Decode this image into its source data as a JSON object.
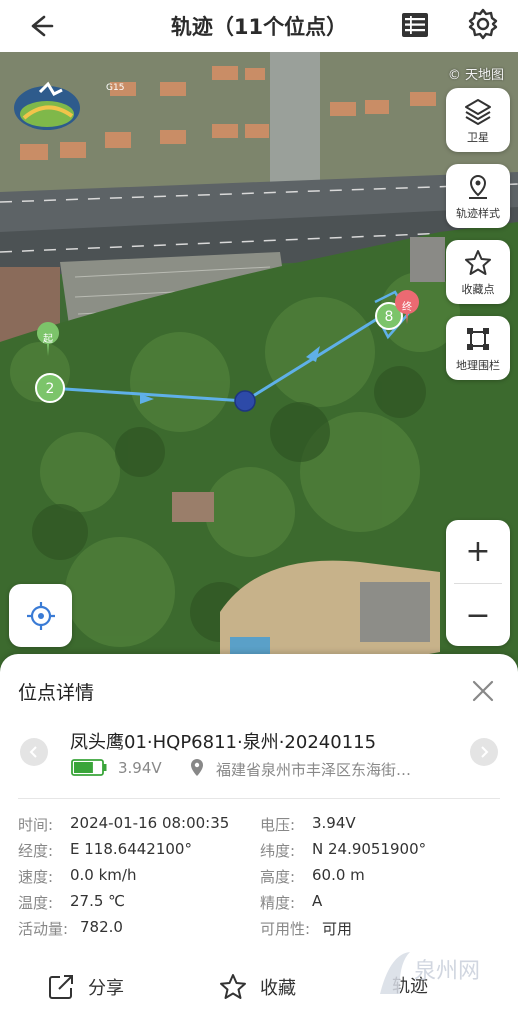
{
  "header": {
    "title": "轨迹（11个位点）"
  },
  "map": {
    "attribution": "© 天地图",
    "start_marker_label": "起",
    "end_marker_label": "终",
    "start_point_number": "2",
    "end_point_number": "8",
    "road_label": "G15",
    "side_buttons": [
      {
        "label": "卫星",
        "icon": "layers-icon"
      },
      {
        "label": "轨迹样式",
        "icon": "map-pin-icon"
      },
      {
        "label": "收藏点",
        "icon": "star-icon"
      },
      {
        "label": "地理围栏",
        "icon": "geofence-icon"
      }
    ],
    "zoom_in": "+",
    "zoom_out": "−",
    "track_color": "#5fb0e8",
    "selected_point_color": "#2d4aa8",
    "start_marker_color": "#7cc46a",
    "end_marker_color": "#ec6a72"
  },
  "panel": {
    "title": "位点详情",
    "device_name": "凤头鹰01·HQP6811·泉州·20240115",
    "battery_voltage": "3.94V",
    "battery_level": 0.7,
    "address": "福建省泉州市丰泽区东海街…",
    "details": [
      {
        "k1": "时间:",
        "v1": "2024-01-16 08:00:35",
        "k2": "电压:",
        "v2": "3.94V"
      },
      {
        "k1": "经度:",
        "v1": "E 118.6442100°",
        "k2": "纬度:",
        "v2": "N 24.9051900°"
      },
      {
        "k1": "速度:",
        "v1": "0.0 km/h",
        "k2": "高度:",
        "v2": "60.0 m"
      },
      {
        "k1": "温度:",
        "v1": "27.5 ℃",
        "k2": "精度:",
        "v2": "A"
      },
      {
        "k1": "活动量:",
        "v1": "782.0",
        "k2": "可用性:",
        "v2": "可用"
      }
    ],
    "actions": {
      "share": "分享",
      "favorite": "收藏",
      "more": "轨迹"
    },
    "watermark": "泉州网"
  }
}
